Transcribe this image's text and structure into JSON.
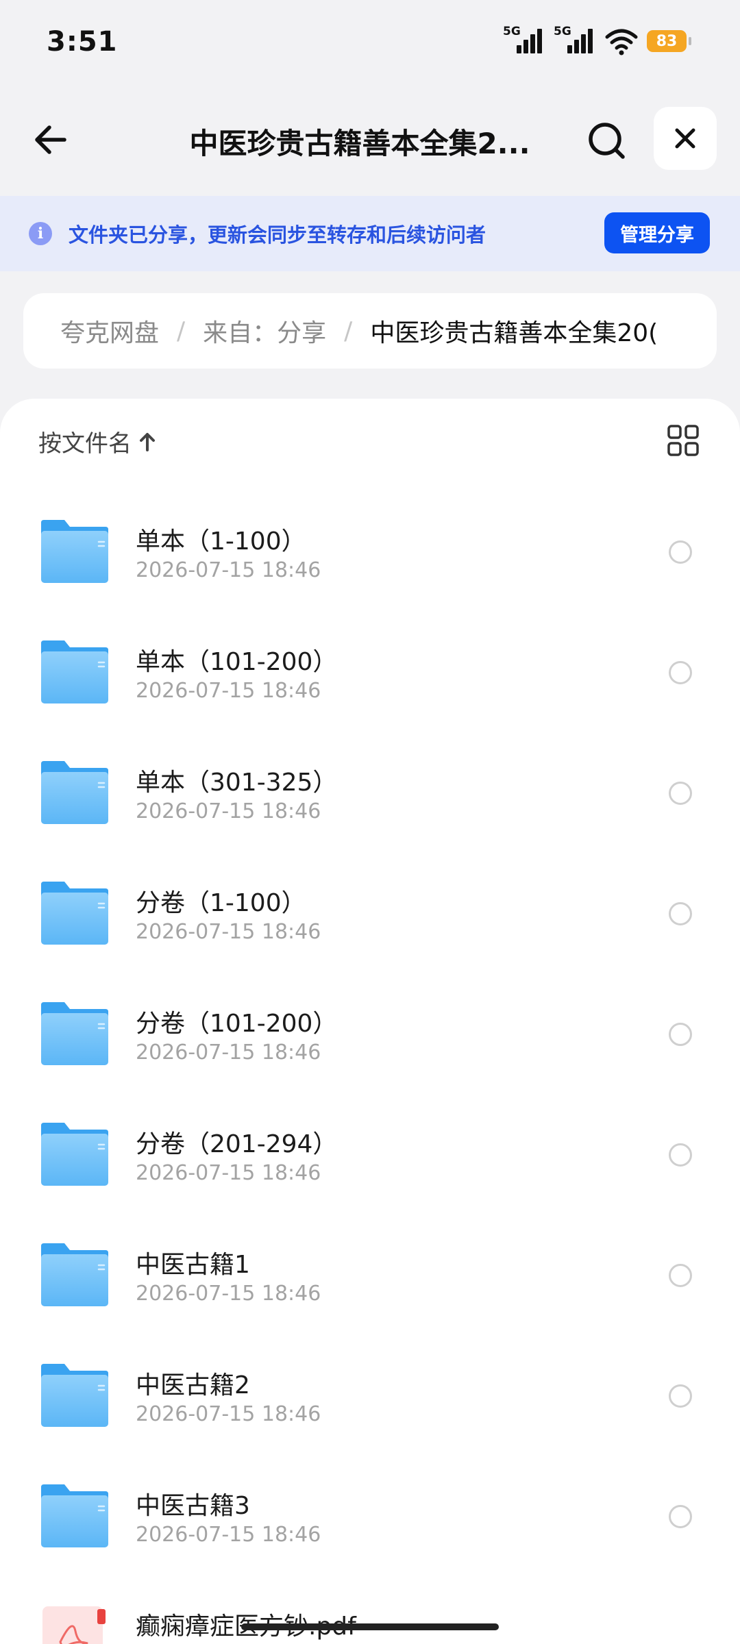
{
  "status_bar": {
    "time": "3:51",
    "signal_1": "5G",
    "signal_2": "5G",
    "battery": "83",
    "battery_color": "#f5a623"
  },
  "header": {
    "title": "中医珍贵古籍善本全集2...",
    "back_icon": "back-arrow-icon",
    "search_icon": "search-icon",
    "close_icon": "close-icon"
  },
  "share_banner": {
    "icon": "info-icon",
    "icon_glyph": "i",
    "text": "文件夹已分享，更新会同步至转存和后续访问者",
    "button": "管理分享",
    "accent_color": "#0d53f2"
  },
  "breadcrumb": {
    "items": [
      "夸克网盘",
      "来自：分享"
    ],
    "separator": "/",
    "current": "中医珍贵古籍善本全集20("
  },
  "list": {
    "sort_label": "按文件名",
    "sort_icon": "sort-up-arrow-icon",
    "view_toggle_icon": "grid-view-icon",
    "files": [
      {
        "name": "单本（1-100）",
        "date": "2026-07-15 18:46",
        "type": "folder"
      },
      {
        "name": "单本（101-200）",
        "date": "2026-07-15 18:46",
        "type": "folder"
      },
      {
        "name": "单本（301-325）",
        "date": "2026-07-15 18:46",
        "type": "folder"
      },
      {
        "name": "分卷（1-100）",
        "date": "2026-07-15 18:46",
        "type": "folder"
      },
      {
        "name": "分卷（101-200）",
        "date": "2026-07-15 18:46",
        "type": "folder"
      },
      {
        "name": "分卷（201-294）",
        "date": "2026-07-15 18:46",
        "type": "folder"
      },
      {
        "name": "中医古籍1",
        "date": "2026-07-15 18:46",
        "type": "folder"
      },
      {
        "name": "中医古籍2",
        "date": "2026-07-15 18:46",
        "type": "folder"
      },
      {
        "name": "中医古籍3",
        "date": "2026-07-15 18:46",
        "type": "folder"
      },
      {
        "name": "癫痫瘴症医方钞.pdf",
        "date": "",
        "type": "pdf"
      }
    ]
  }
}
